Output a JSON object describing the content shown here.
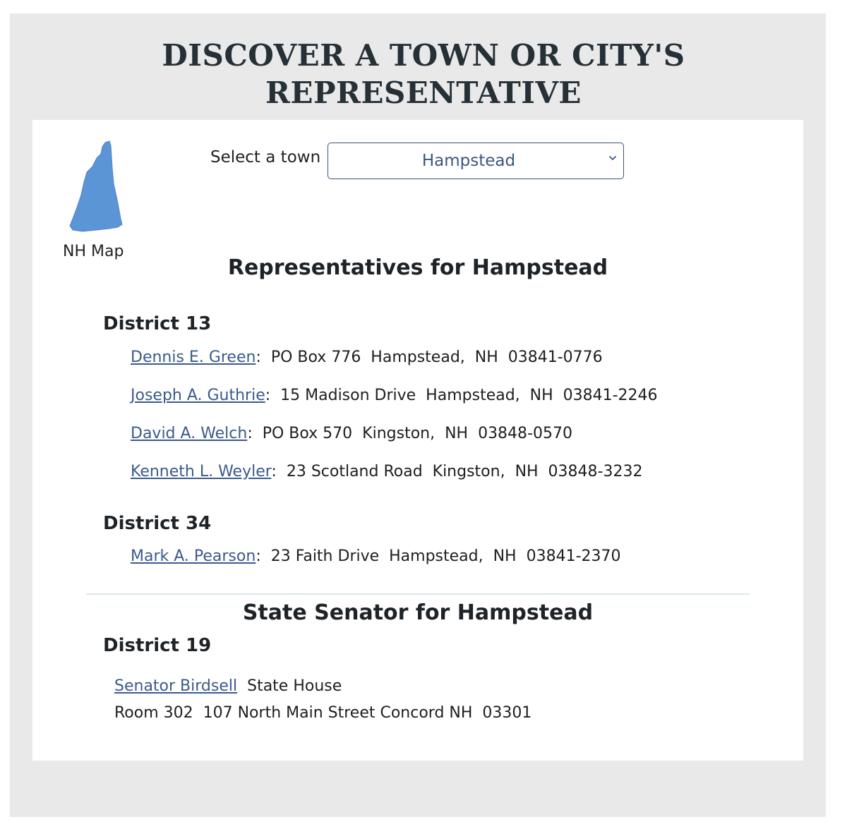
{
  "page_title_line1": "DISCOVER A TOWN OR CITY'S",
  "page_title_line2": "REPRESENTATIVE",
  "map": {
    "label": "NH Map",
    "icon": "nh-state-shape-icon",
    "color": "#5b95d6"
  },
  "town_select": {
    "label": "Select a town",
    "value": "Hampstead",
    "icon": "chevron-down-icon"
  },
  "representatives": {
    "heading": "Representatives for Hampstead",
    "districts": [
      {
        "name": "District 13",
        "reps": [
          {
            "name": "Dennis E. Green",
            "address": "PO Box 776  Hampstead,  NH  03841-0776"
          },
          {
            "name": "Joseph A. Guthrie",
            "address": "15 Madison Drive  Hampstead,  NH  03841-2246"
          },
          {
            "name": "David A. Welch",
            "address": "PO Box 570  Kingston,  NH  03848-0570"
          },
          {
            "name": "Kenneth L. Weyler",
            "address": "23 Scotland Road  Kingston,  NH  03848-3232"
          }
        ]
      },
      {
        "name": "District 34",
        "reps": [
          {
            "name": "Mark A. Pearson",
            "address": "23 Faith Drive  Hampstead,  NH  03841-2370"
          }
        ]
      }
    ]
  },
  "senator": {
    "heading": "State Senator for Hampstead",
    "district": "District 19",
    "name": "Senator Birdsell",
    "address_line1": "State House",
    "address_line2": "Room 302  107 North Main Street Concord NH  03301"
  },
  "colors": {
    "link": "#3b5a8c",
    "outer_bg": "#e9e9e9",
    "title": "#263037"
  }
}
